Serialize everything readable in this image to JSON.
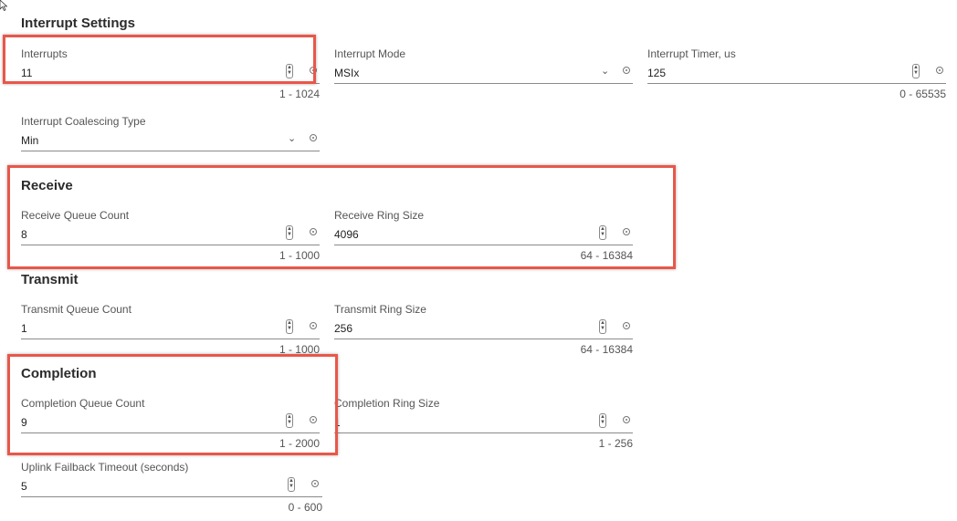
{
  "sections": {
    "interrupt": "Interrupt Settings",
    "receive": "Receive",
    "transmit": "Transmit",
    "completion": "Completion"
  },
  "fields": {
    "interrupts": {
      "label": "Interrupts",
      "value": "11",
      "range": "1 - 1024"
    },
    "interrupt_mode": {
      "label": "Interrupt Mode",
      "value": "MSIx"
    },
    "interrupt_timer": {
      "label": "Interrupt Timer, us",
      "value": "125",
      "range": "0 - 65535"
    },
    "coalescing_type": {
      "label": "Interrupt Coalescing Type",
      "value": "Min"
    },
    "receive_queue_count": {
      "label": "Receive Queue Count",
      "value": "8",
      "range": "1 - 1000"
    },
    "receive_ring_size": {
      "label": "Receive Ring Size",
      "value": "4096",
      "range": "64 - 16384"
    },
    "transmit_queue_count": {
      "label": "Transmit Queue Count",
      "value": "1",
      "range": "1 - 1000"
    },
    "transmit_ring_size": {
      "label": "Transmit Ring Size",
      "value": "256",
      "range": "64 - 16384"
    },
    "completion_queue_count": {
      "label": "Completion Queue Count",
      "value": "9",
      "range": "1 - 2000"
    },
    "completion_ring_size": {
      "label": "Completion Ring Size",
      "value": "1",
      "range": "1 - 256"
    },
    "uplink_failback_timeout": {
      "label": "Uplink Failback Timeout (seconds)",
      "value": "5",
      "range": "0 - 600"
    }
  },
  "colors": {
    "highlight": "#e8574a"
  }
}
